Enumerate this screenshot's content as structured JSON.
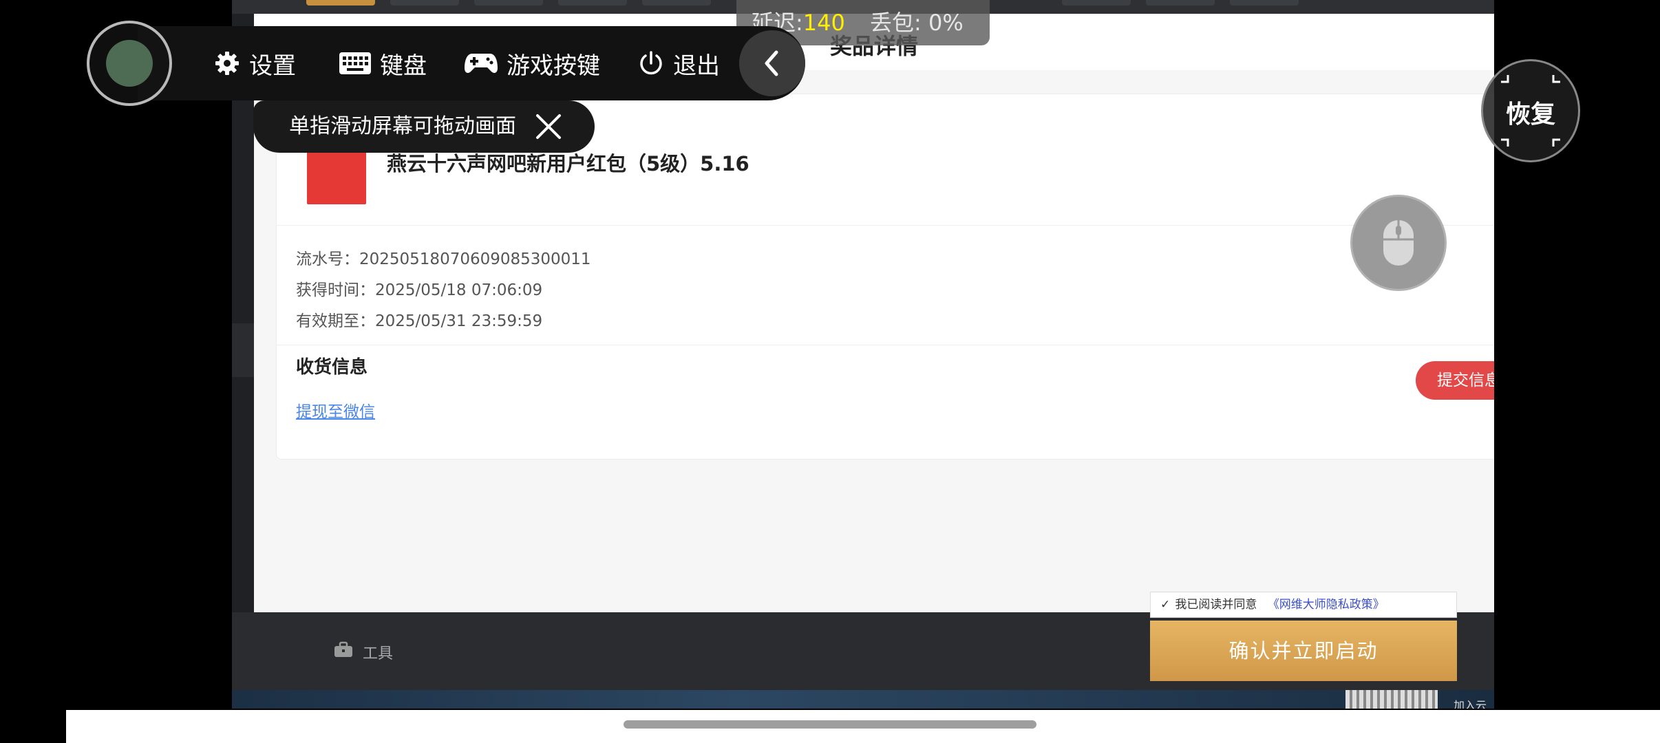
{
  "overlay": {
    "latency_label": "延迟:",
    "latency_value": "140",
    "packet_loss": "丢包: 0%",
    "toolbar": {
      "settings": "设置",
      "keyboard": "键盘",
      "game_keys": "游戏按键",
      "exit": "退出"
    },
    "hint": "单指滑动屏幕可拖动画面",
    "restore": "恢复"
  },
  "page": {
    "title": "奖品详情",
    "prize_name": "燕云十六声网吧新用户红包（5级）5.16",
    "serial": "流水号：20250518070609085300011",
    "obtained": "获得时间：2025/05/18 07:06:09",
    "expires": "有效期至：2025/05/31 23:59:59",
    "shipping_title": "收货信息",
    "withdraw_link": "提现至微信",
    "submit_button": "提交信息"
  },
  "bottom": {
    "toolbox": "工具",
    "agree_text": "我已阅读并同意",
    "policy_link": "《网维大师隐私政策》",
    "confirm_button": "确认并立即启动",
    "join_text": "加入云"
  },
  "colors": {
    "accent_red": "#e24847",
    "gold": "#d9a553",
    "latency_yellow": "#ffee00"
  }
}
